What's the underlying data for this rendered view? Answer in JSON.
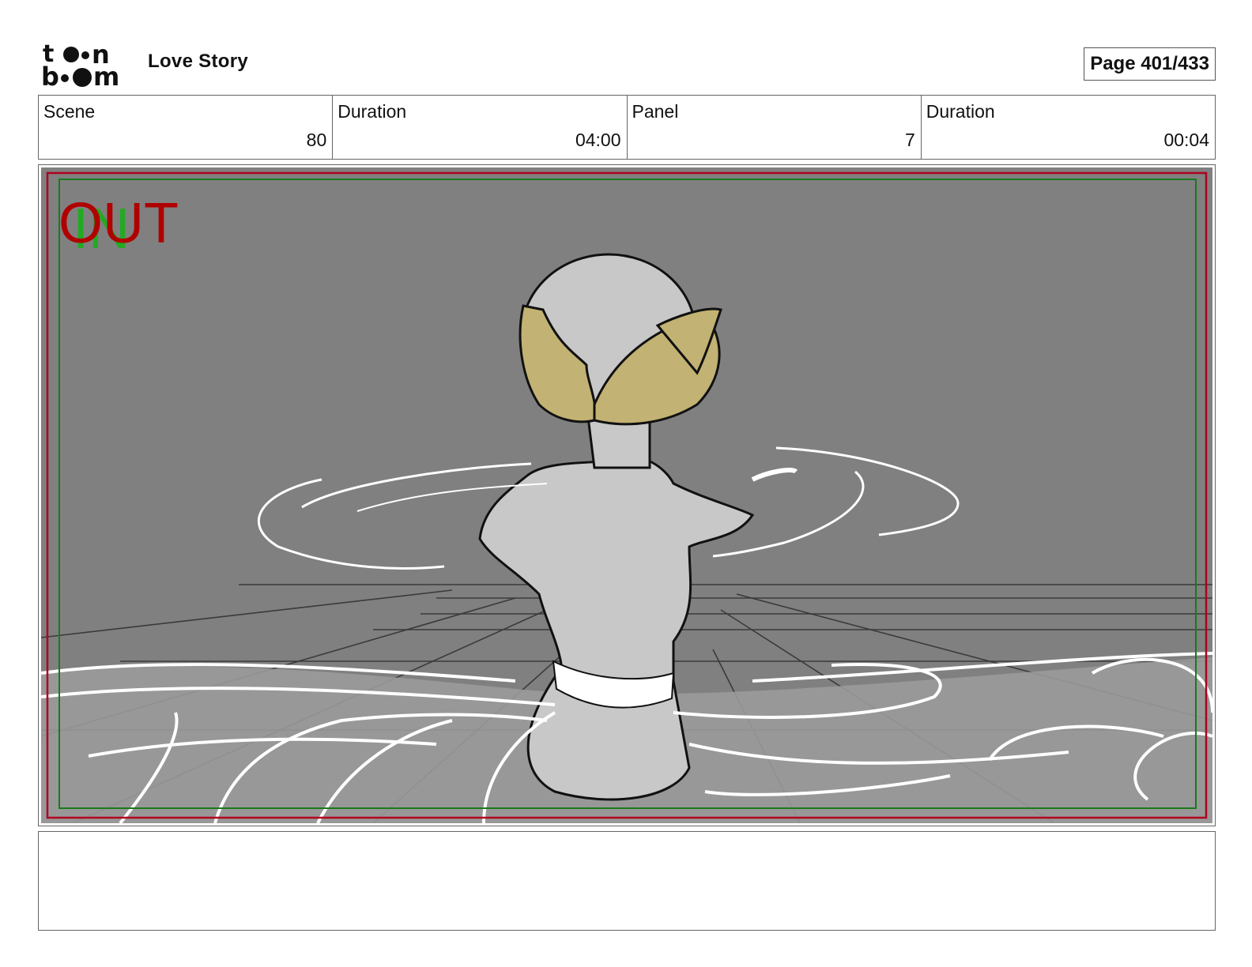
{
  "header": {
    "logo_text": "toonboom",
    "project_title": "Love Story",
    "page_label": "Page 401/433"
  },
  "info": {
    "scene_label": "Scene",
    "scene_value": "80",
    "duration_label": "Duration",
    "duration_value": "04:00",
    "panel_label": "Panel",
    "panel_value": "7",
    "panel_duration_label": "Duration",
    "panel_duration_value": "00:04"
  },
  "panel": {
    "overlay_out": "OUT",
    "overlay_in": "IN",
    "colors": {
      "background": "#808080",
      "hair": "#c2b273",
      "skin": "#cccccc",
      "frame_out": "#b0001e",
      "frame_in": "#1a7a1a",
      "text_out": "#b00000",
      "text_in": "#22aa22"
    }
  },
  "notes": {
    "text": ""
  }
}
